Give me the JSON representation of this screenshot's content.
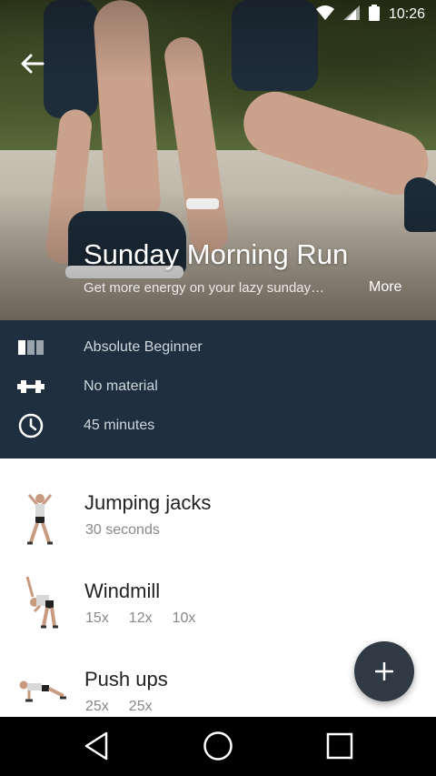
{
  "status_bar": {
    "time": "10:26"
  },
  "hero": {
    "title": "Sunday Morning Run",
    "subtitle": "Get more energy on your lazy sunday…",
    "more_label": "More"
  },
  "info": [
    {
      "icon": "level-icon",
      "label": "Absolute Beginner"
    },
    {
      "icon": "dumbbell-icon",
      "label": "No material"
    },
    {
      "icon": "clock-icon",
      "label": "45 minutes"
    }
  ],
  "exercises": [
    {
      "name": "Jumping jacks",
      "reps": [
        "30 seconds"
      ]
    },
    {
      "name": "Windmill",
      "reps": [
        "15x",
        "12x",
        "10x"
      ]
    },
    {
      "name": "Push ups",
      "reps": [
        "25x",
        "25x"
      ]
    }
  ],
  "fab": {
    "icon": "plus-icon"
  },
  "navbar": {
    "back": "back-triangle-icon",
    "home": "home-circle-icon",
    "recents": "recents-square-icon"
  }
}
